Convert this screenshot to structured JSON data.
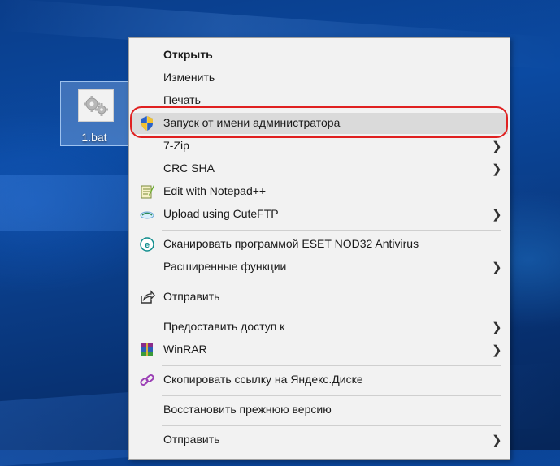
{
  "desktop": {
    "file_label": "1.bat",
    "file_icon": "batch-file-gear-icon"
  },
  "menu": {
    "items": [
      {
        "label": "Открыть",
        "bold": true,
        "icon": null,
        "submenu": false
      },
      {
        "label": "Изменить",
        "icon": null,
        "submenu": false
      },
      {
        "label": "Печать",
        "icon": null,
        "submenu": false
      },
      {
        "label": "Запуск от имени администратора",
        "icon": "uac-shield-icon",
        "submenu": false,
        "highlighted": true
      },
      {
        "label": "7-Zip",
        "icon": null,
        "submenu": true
      },
      {
        "label": "CRC SHA",
        "icon": null,
        "submenu": true
      },
      {
        "label": "Edit with Notepad++",
        "icon": "notepad-plus-plus-icon",
        "submenu": false
      },
      {
        "label": "Upload using CuteFTP",
        "icon": "cuteftp-icon",
        "submenu": true
      },
      {
        "label": "Сканировать программой ESET NOD32 Antivirus",
        "icon": "eset-icon",
        "submenu": false
      },
      {
        "label": "Расширенные функции",
        "icon": null,
        "submenu": true
      },
      {
        "label": "Отправить",
        "icon": "share-icon",
        "submenu": false
      },
      {
        "label": "Предоставить доступ к",
        "icon": null,
        "submenu": true
      },
      {
        "label": "WinRAR",
        "icon": "winrar-icon",
        "submenu": true
      },
      {
        "label": "Скопировать ссылку на Яндекс.Диске",
        "icon": "link-icon",
        "submenu": false
      },
      {
        "label": "Восстановить прежнюю версию",
        "icon": null,
        "submenu": false
      },
      {
        "label": "Отправить",
        "icon": null,
        "submenu": true
      }
    ]
  },
  "colors": {
    "highlight_oval": "#e02020",
    "menu_background": "#f2f2f2",
    "hover_background": "#dadada"
  }
}
